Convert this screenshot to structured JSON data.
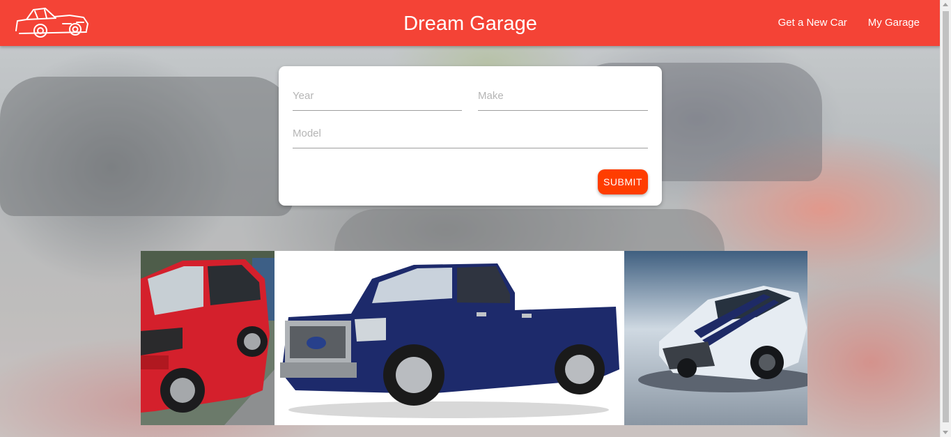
{
  "navbar": {
    "brand": "Dream Garage",
    "logo_icon": "car-outline-icon",
    "links": [
      "Get a New Car",
      "My Garage"
    ],
    "color": "#f44336"
  },
  "form": {
    "year_placeholder": "Year",
    "make_placeholder": "Make",
    "model_placeholder": "Model",
    "submit_label": "SUBMIT",
    "submit_color": "#ff3d00"
  },
  "gallery": {
    "photos": [
      {
        "name": "red-suv-photo",
        "color": "#d4202c"
      },
      {
        "name": "blue-pickup-truck-photo",
        "color": "#1d2a6b"
      },
      {
        "name": "white-mustang-photo",
        "color": "#e6ecf2"
      }
    ]
  }
}
